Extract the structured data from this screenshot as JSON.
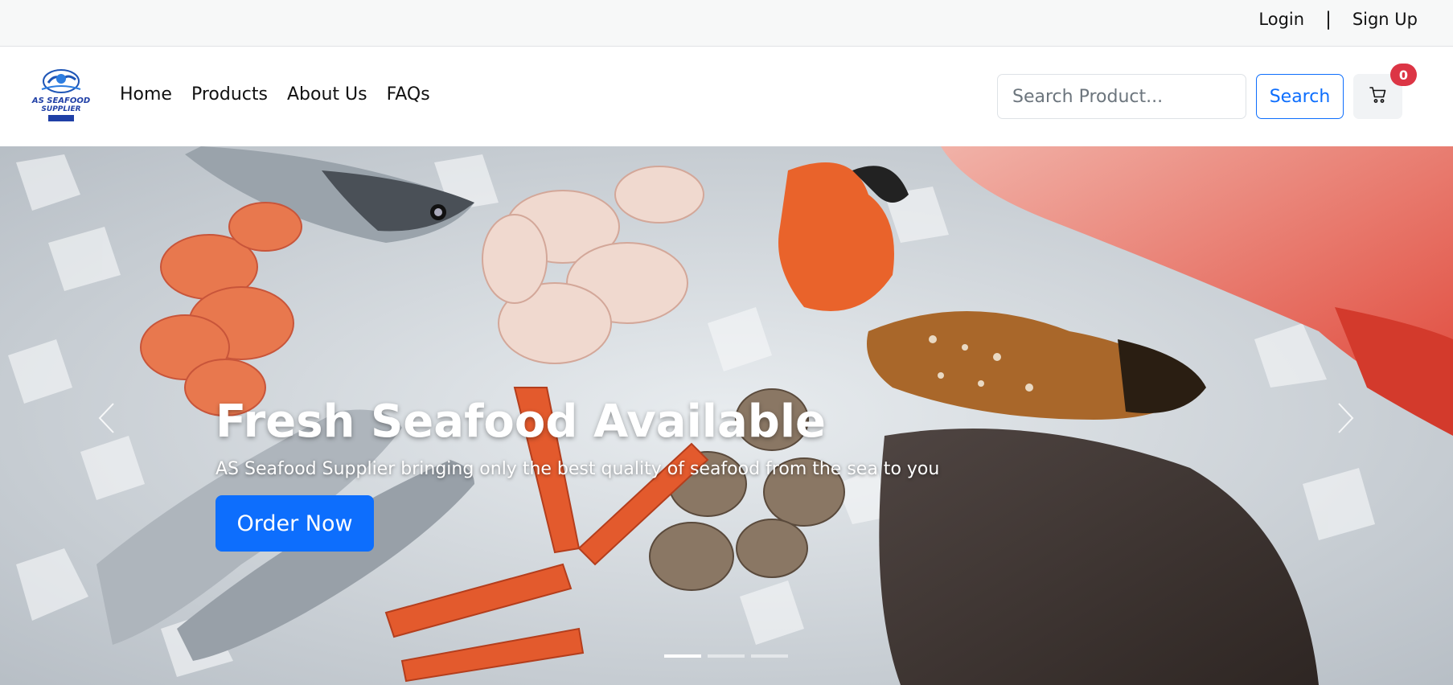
{
  "topbar": {
    "login": "Login",
    "separator": "|",
    "signup": "Sign Up"
  },
  "brand": {
    "logo_text_1": "AS SEAFOOD",
    "logo_text_2": "SUPPLIER"
  },
  "nav": {
    "items": [
      "Home",
      "Products",
      "About Us",
      "FAQs"
    ]
  },
  "search": {
    "placeholder": "Search Product...",
    "button_label": "Search"
  },
  "cart": {
    "count": "0"
  },
  "hero": {
    "title": "Fresh Seafood Available",
    "subtitle": "AS Seafood Supplier bringing only the best quality of seafood from the sea to you",
    "cta": "Order Now",
    "slides": 3,
    "active_slide": 1
  },
  "colors": {
    "primary": "#0d6efd",
    "badge": "#dc3545",
    "topbar_bg": "#f7f8f8"
  },
  "icons": {
    "cart": "cart-icon",
    "prev": "chevron-left-icon",
    "next": "chevron-right-icon"
  }
}
